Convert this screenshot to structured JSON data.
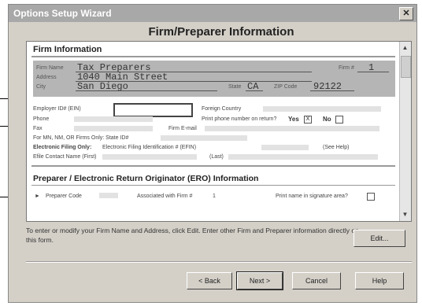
{
  "window": {
    "title": "Options Setup Wizard",
    "close_glyph": "✕"
  },
  "page_title": "Firm/Preparer Information",
  "firm_section": {
    "title": "Firm Information",
    "firm_name_label": "Firm Name",
    "firm_name": "Tax Preparers",
    "firm_num_label": "Firm #",
    "firm_num": "1",
    "address_label": "Address",
    "address": "1040 Main Street",
    "city_label": "City",
    "city": "San Diego",
    "state_label": "State",
    "state": "CA",
    "zip_label": "ZIP Code",
    "zip": "92122"
  },
  "details": {
    "ein_label": "Employer ID# (EIN)",
    "foreign_country_label": "Foreign Country",
    "phone_label": "Phone",
    "print_phone_label": "Print phone number on return?",
    "yes_label": "Yes",
    "no_label": "No",
    "yes_checked": "X",
    "fax_label": "Fax",
    "firm_email_label": "Firm E-mail",
    "state_id_label": "For MN, NM, OR Firms Only: State ID#",
    "efin_label_bold": "Electronic Filing Only:",
    "efin_label": "Electronic Filing Identification # (EFIN)",
    "see_help": "(See Help)",
    "efile_contact_first_label": "Efile Contact Name (First)",
    "efile_contact_last_label": "(Last)"
  },
  "ero_section": {
    "title": "Preparer / Electronic Return Originator (ERO) Information",
    "preparer_code_label": "Preparer Code",
    "associated_label": "Associated with Firm #",
    "associated_value": "1",
    "print_name_label": "Print name in signature area?"
  },
  "hint_text": "To enter or modify your Firm Name and Address, click Edit. Enter other Firm and Preparer information directly on this form.",
  "buttons": {
    "edit": "Edit...",
    "back": "< Back",
    "next": "Next >",
    "cancel": "Cancel",
    "help": "Help"
  }
}
